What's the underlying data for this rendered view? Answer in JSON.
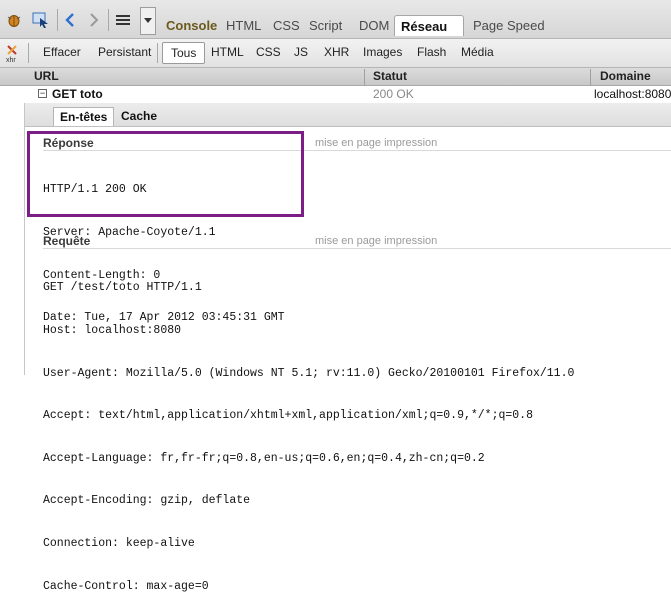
{
  "toolbar": {
    "icons": [
      "firebug-bug-icon",
      "inspect-icon",
      "back-arrow-icon",
      "forward-arrow-icon",
      "menu-lines-icon",
      "dropdown-arrow-icon"
    ],
    "panels": [
      "Console",
      "HTML",
      "CSS",
      "Script",
      "DOM",
      "Réseau",
      "Page Speed"
    ],
    "active_panel": "Réseau"
  },
  "subtoolbar": {
    "clear": "Effacer",
    "persist": "Persistant",
    "filters": [
      "Tous",
      "HTML",
      "CSS",
      "JS",
      "XHR",
      "Images",
      "Flash",
      "Média"
    ],
    "active_filter": "Tous"
  },
  "columns": {
    "url": "URL",
    "status": "Statut",
    "domain": "Domaine"
  },
  "request": {
    "label": "GET toto",
    "status": "200 OK",
    "domain": "localhost:8080"
  },
  "detail_tabs": [
    "En-têtes",
    "Cache"
  ],
  "response": {
    "title": "Réponse",
    "link": "mise en page impression",
    "lines": [
      "HTTP/1.1 200 OK",
      "Server: Apache-Coyote/1.1",
      "Content-Length: 0",
      "Date: Tue, 17 Apr 2012 03:45:31 GMT"
    ]
  },
  "request_headers": {
    "title": "Requête",
    "link": "mise en page impression",
    "lines": [
      "GET /test/toto HTTP/1.1",
      "Host: localhost:8080",
      "User-Agent: Mozilla/5.0 (Windows NT 5.1; rv:11.0) Gecko/20100101 Firefox/11.0",
      "Accept: text/html,application/xhtml+xml,application/xml;q=0.9,*/*;q=0.8",
      "Accept-Language: fr,fr-fr;q=0.8,en-us;q=0.6,en;q=0.4,zh-cn;q=0.2",
      "Accept-Encoding: gzip, deflate",
      "Connection: keep-alive",
      "Cache-Control: max-age=0"
    ]
  },
  "colors": {
    "highlight": "#7b1f86",
    "console": "#6b5a1c"
  }
}
